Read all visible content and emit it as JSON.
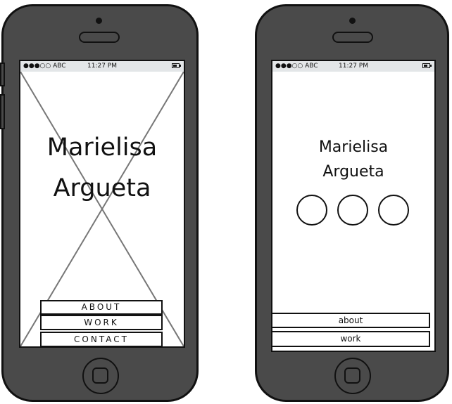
{
  "status_bar": {
    "carrier": "●●●○○ ABC",
    "time": "11:27 PM"
  },
  "left_mockup": {
    "name_line1": "Marielisa",
    "name_line2": "Argueta",
    "nav": [
      "ABOUT",
      "WORK",
      "CONTACT"
    ]
  },
  "right_mockup": {
    "name_line1": "Marielisa",
    "name_line2": "Argueta",
    "circle_count": 3,
    "nav": [
      "about",
      "work"
    ]
  }
}
